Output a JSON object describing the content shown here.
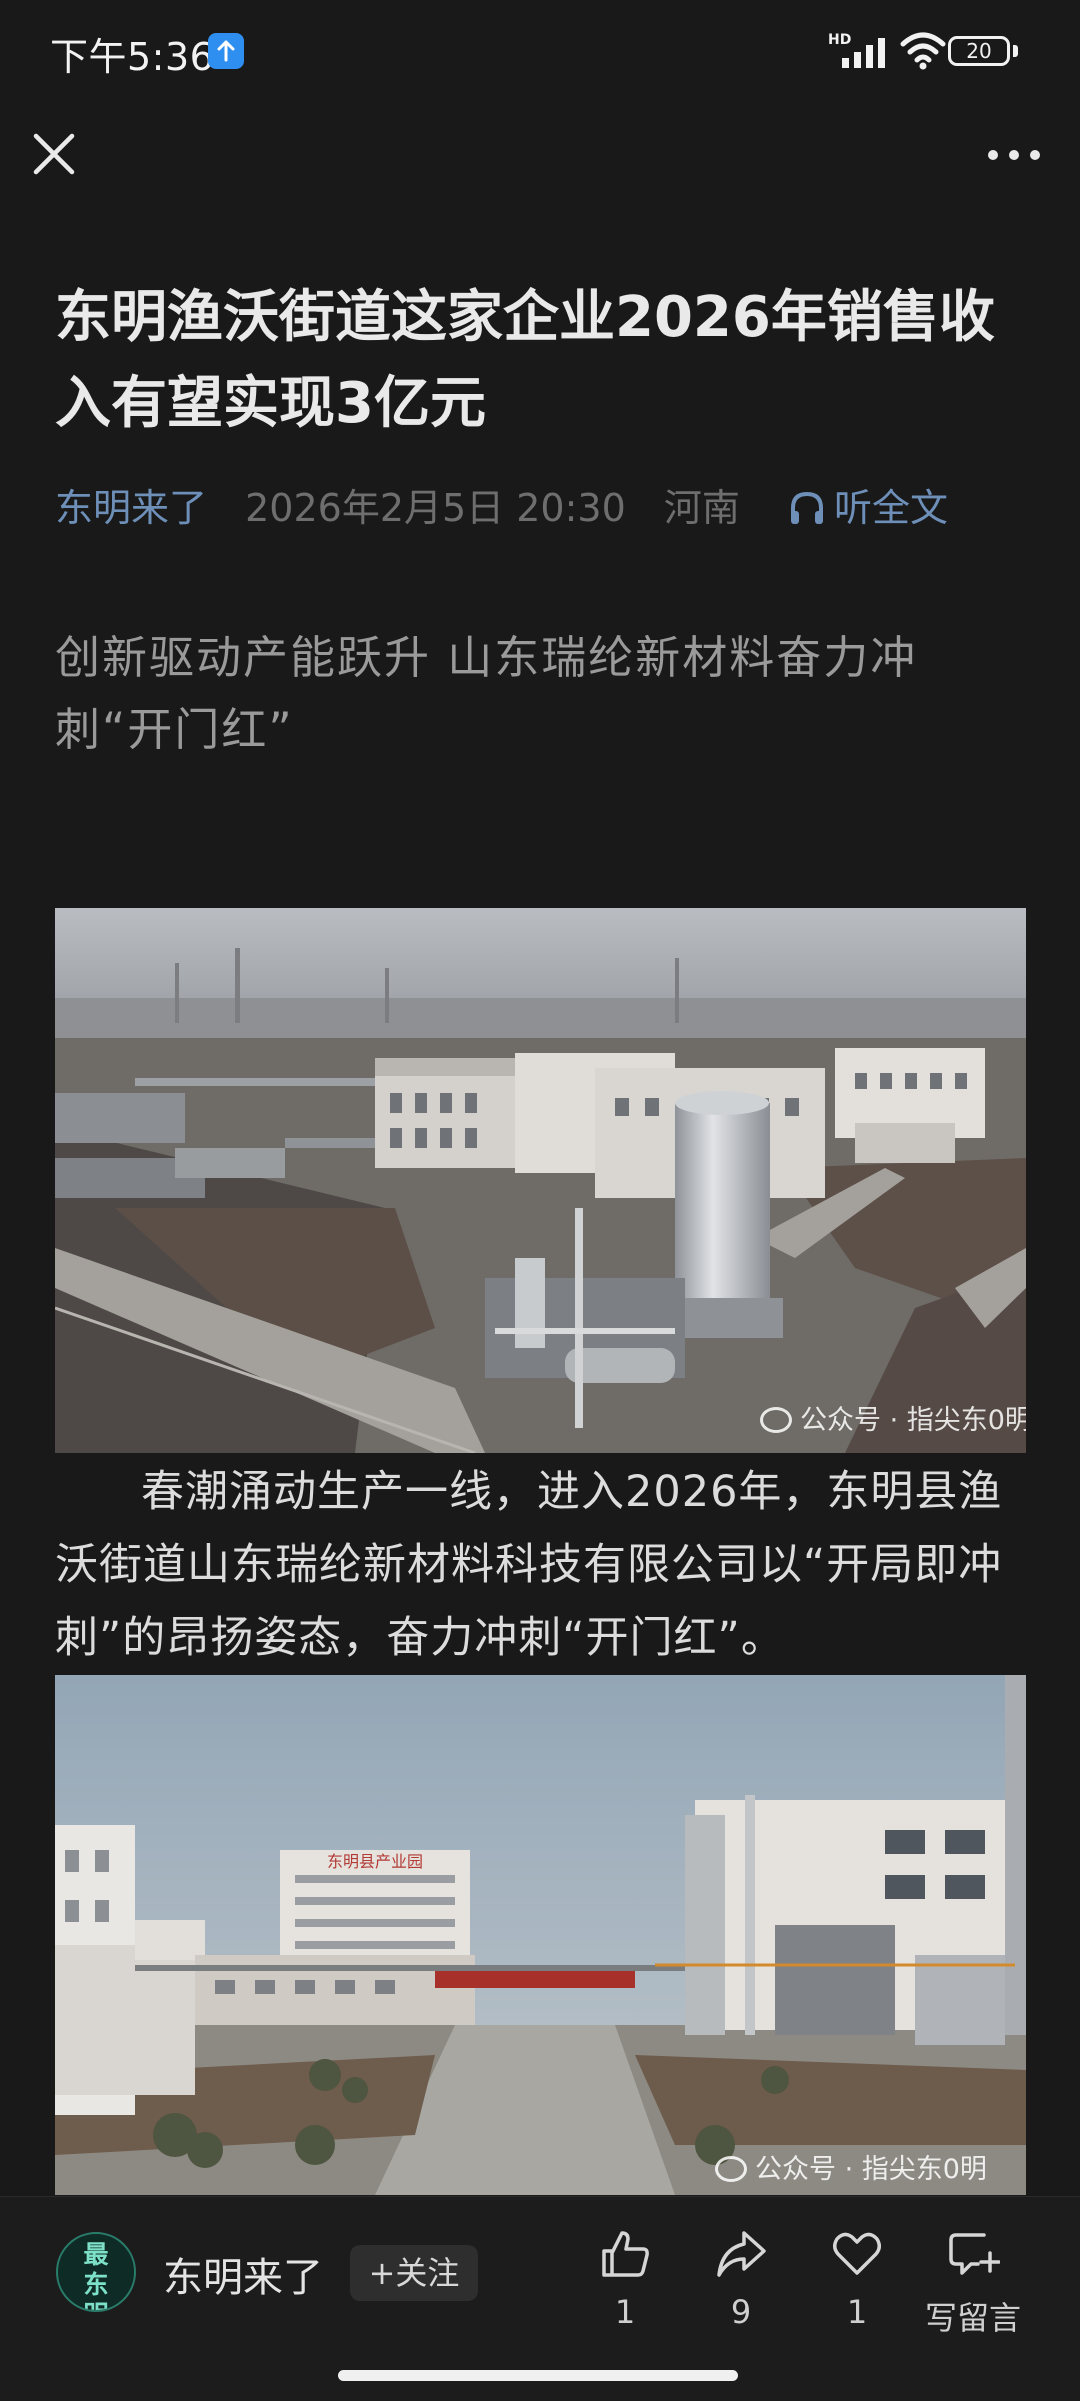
{
  "status_bar": {
    "time": "下午5:36",
    "network_label": "HD",
    "battery": "20"
  },
  "article": {
    "title": "东明渔沃街道这家企业2026年销售收入有望实现3亿元",
    "author": "东明来了",
    "date": "2026年2月5日 20:30",
    "region": "河南",
    "listen_label": "听全文",
    "subtitle": "创新驱动产能跃升 山东瑞纶新材料奋力冲刺“开门红”",
    "paragraph": "春潮涌动生产一线，进入2026年，东明县渔沃街道山东瑞纶新材料科技有限公司以“开局即冲刺”的昂扬姿态，奋力冲刺“开门红”。",
    "watermark": "公众号 · 指尖东0明",
    "photo2_sign": "东明县产业园"
  },
  "bottom_bar": {
    "avatar_text": "最东明",
    "account_name": "东明来了",
    "follow_label": "+关注",
    "like_count": "1",
    "share_count": "9",
    "favorite_count": "1",
    "comment_label": "写留言"
  },
  "colors": {
    "background": "#191919",
    "link": "#6d8fb8",
    "muted": "#6e6e6e"
  }
}
